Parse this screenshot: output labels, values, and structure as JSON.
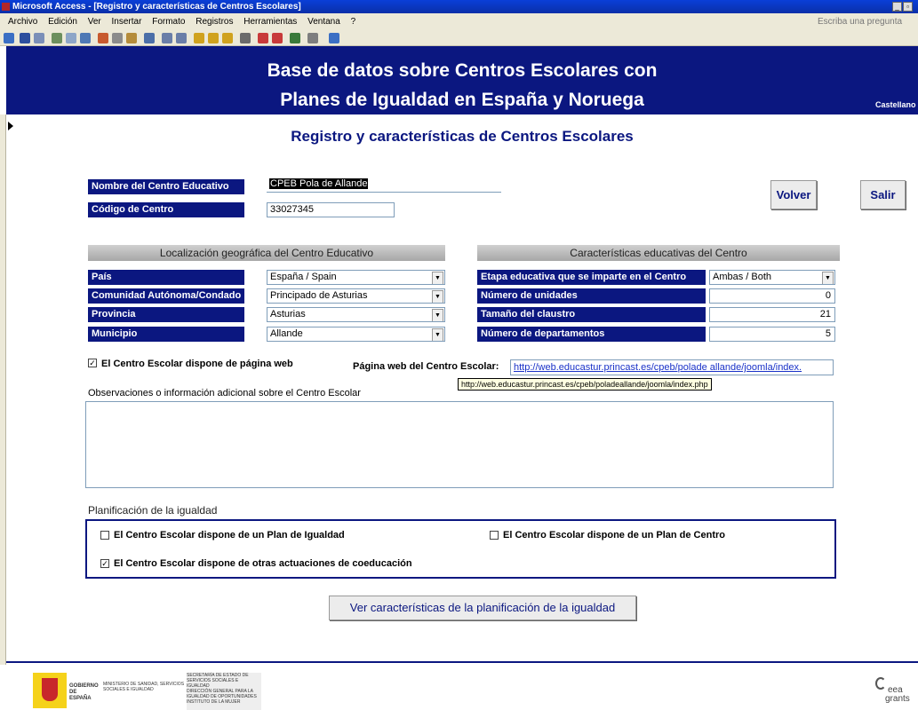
{
  "window": {
    "title": "Microsoft Access  - [Registro y características de Centros Escolares]",
    "help_placeholder": "Escriba una pregunta",
    "menu": [
      "Archivo",
      "Edición",
      "Ver",
      "Insertar",
      "Formato",
      "Registros",
      "Herramientas",
      "Ventana",
      "?"
    ]
  },
  "header": {
    "title_line1": "Base de datos sobre Centros Escolares con",
    "title_line2": "Planes de Igualdad en España y Noruega",
    "language": "Castellano"
  },
  "form": {
    "title": "Registro y características de Centros Escolares",
    "nombre_label": "Nombre del Centro Educativo",
    "nombre_value": "CPEB Pola de Allande",
    "codigo_label": "Código de Centro",
    "codigo_value": "33027345",
    "volver_label": "Volver",
    "salir_label": "Salir"
  },
  "localizacion": {
    "heading": "Localización geográfica del Centro Educativo",
    "pais_label": "País",
    "pais_value": "España / Spain",
    "comunidad_label": "Comunidad Autónoma/Condado",
    "comunidad_value": "Principado de Asturias",
    "provincia_label": "Provincia",
    "provincia_value": "Asturias",
    "municipio_label": "Municipio",
    "municipio_value": "Allande"
  },
  "caracteristicas": {
    "heading": "Características educativas del Centro",
    "etapa_label": "Etapa educativa que se imparte en el Centro",
    "etapa_value": "Ambas / Both",
    "unidades_label": "Número de unidades",
    "unidades_value": "0",
    "claustro_label": "Tamaño del claustro",
    "claustro_value": "21",
    "departamentos_label": "Número de departamentos",
    "departamentos_value": "5"
  },
  "web": {
    "checkbox_label": "El Centro Escolar dispone de página web",
    "checkbox_checked": true,
    "url_label": "Página web del Centro Escolar:",
    "url_value": "http://web.educastur.princast.es/cpeb/polade allande/joomla/index.",
    "tooltip": "http://web.educastur.princast.es/cpeb/poladeallande/joomla/index.php"
  },
  "observaciones": {
    "label": "Observaciones o información adicional sobre el Centro Escolar",
    "value": ""
  },
  "planificacion": {
    "heading": "Planificación de la igualdad",
    "plan_igualdad_label": "El Centro Escolar dispone de un Plan de Igualdad",
    "plan_igualdad_checked": false,
    "plan_centro_label": "El Centro Escolar dispone de un Plan de Centro",
    "plan_centro_checked": false,
    "coeducacion_label": "El Centro Escolar dispone de otras actuaciones de coeducación",
    "coeducacion_checked": true,
    "ver_button": "Ver características de la planificación de la igualdad"
  },
  "footer": {
    "gobierno": "GOBIERNO DE ESPAÑA",
    "ministerio": "MINISTERIO DE SANIDAD, SERVICIOS SOCIALES E IGUALDAD",
    "secretaria": "SECRETARÍA DE ESTADO DE SERVICIOS SOCIALES E IGUALDAD",
    "direccion": "DIRECCIÓN GENERAL PARA LA IGUALDAD DE OPORTUNIDADES",
    "instituto": "INSTITUTO DE LA MUJER",
    "eea": "eea",
    "grants": "grants"
  },
  "colors": {
    "navy": "#0b1780",
    "titlebar": "#0a3fd8"
  }
}
